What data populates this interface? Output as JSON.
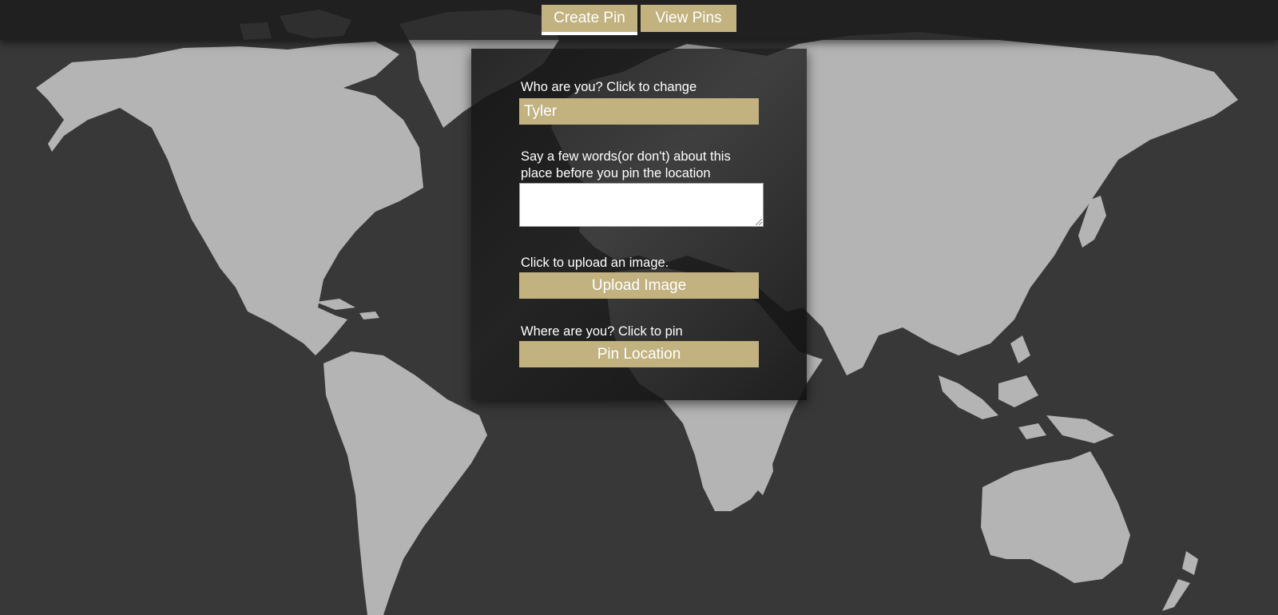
{
  "nav": {
    "create_pin": "Create Pin",
    "view_pins": "View Pins"
  },
  "form": {
    "name_label": "Who are you? Click to change",
    "name_value": "Tyler",
    "about_label": "Say a few words(or don't) about this place before you pin the location",
    "about_value": "",
    "upload_label": "Click to upload an image.",
    "upload_button": "Upload Image",
    "pin_label": "Where are you? Click to pin",
    "pin_button": "Pin Location"
  },
  "colors": {
    "accent": "#c2b280",
    "background": "#383838",
    "land": "#b4b4b4",
    "panel": "#1e1e1e"
  }
}
